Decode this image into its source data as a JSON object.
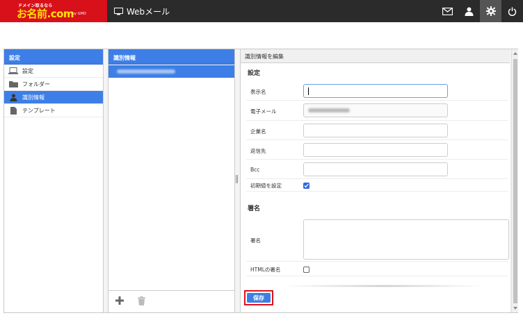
{
  "header": {
    "logo_tagline": "ドメイン取るなら",
    "logo_main": "お名前.com",
    "logo_sub": "by GMO",
    "app_title": "Webメール",
    "icons": [
      "mail-icon",
      "user-icon",
      "gear-icon",
      "power-icon"
    ]
  },
  "left_panel": {
    "title": "設定",
    "items": [
      {
        "label": "設定",
        "icon": "laptop-icon"
      },
      {
        "label": "フォルダー",
        "icon": "folder-icon"
      },
      {
        "label": "識別情報",
        "icon": "person-icon",
        "selected": true
      },
      {
        "label": "テンプレート",
        "icon": "document-icon"
      }
    ]
  },
  "middle_panel": {
    "title": "識別情報",
    "footer_icons": [
      "add-icon",
      "trash-icon"
    ]
  },
  "right_panel": {
    "title": "識別情報を編集",
    "section_settings": "設定",
    "fields": {
      "display_name": "表示名",
      "email": "電子メール",
      "company": "企業名",
      "reply_to": "返信先",
      "bcc": "Bcc",
      "set_default": "初期値を設定"
    },
    "set_default_checked": true,
    "section_signature": "署名",
    "signature_label": "署名",
    "html_signature_label": "HTMLの署名",
    "html_signature_checked": false,
    "save_label": "保存"
  },
  "colors": {
    "accent": "#3d7fe6",
    "topbar": "#2b2b2b",
    "logo_bg": "#d8101a",
    "logo_text": "#ffe300",
    "highlight_border": "#e0101a"
  }
}
